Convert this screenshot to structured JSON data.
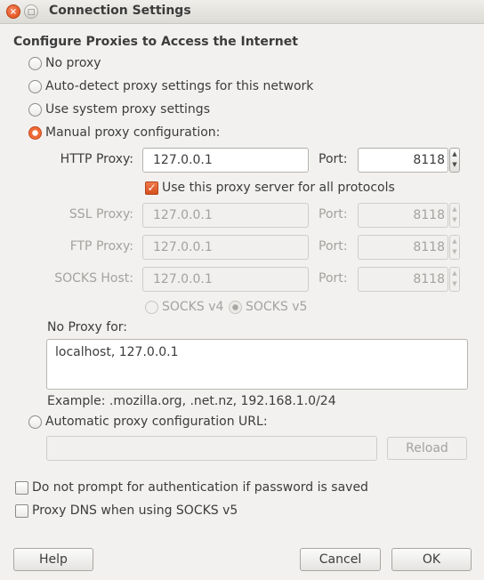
{
  "window": {
    "title": "Connection Settings",
    "close_glyph": "×",
    "maximize_glyph": "□"
  },
  "heading": "Configure Proxies to Access the Internet",
  "proxy_modes": {
    "no_proxy": "No proxy",
    "auto_detect": "Auto-detect proxy settings for this network",
    "system": "Use system proxy settings",
    "manual": "Manual proxy configuration:",
    "selected": "manual"
  },
  "http": {
    "label": "HTTP Proxy:",
    "value": "127.0.0.1",
    "port_label": "Port:",
    "port": "8118"
  },
  "use_for_all": {
    "label": "Use this proxy server for all protocols",
    "checked": true
  },
  "ssl": {
    "label": "SSL Proxy:",
    "value": "127.0.0.1",
    "port_label": "Port:",
    "port": "8118"
  },
  "ftp": {
    "label": "FTP Proxy:",
    "value": "127.0.0.1",
    "port_label": "Port:",
    "port": "8118"
  },
  "socks": {
    "label": "SOCKS Host:",
    "value": "127.0.0.1",
    "port_label": "Port:",
    "port": "8118",
    "v4_label": "SOCKS v4",
    "v5_label": "SOCKS v5",
    "selected": "v5"
  },
  "no_proxy_for": {
    "label": "No Proxy for:",
    "value": "localhost, 127.0.0.1",
    "example": "Example: .mozilla.org, .net.nz, 192.168.1.0/24"
  },
  "auto_url": {
    "label": "Automatic proxy configuration URL:",
    "value": "",
    "reload_label": "Reload"
  },
  "options": {
    "no_auth_prompt": "Do not prompt for authentication if password is saved",
    "proxy_dns": "Proxy DNS when using SOCKS v5"
  },
  "buttons": {
    "help": "Help",
    "cancel": "Cancel",
    "ok": "OK"
  },
  "spin_glyphs": {
    "up": "▲",
    "down": "▼"
  },
  "check_glyph": "✓",
  "colors": {
    "accent": "#ef6b37",
    "window_bg": "#f2f1f0"
  }
}
